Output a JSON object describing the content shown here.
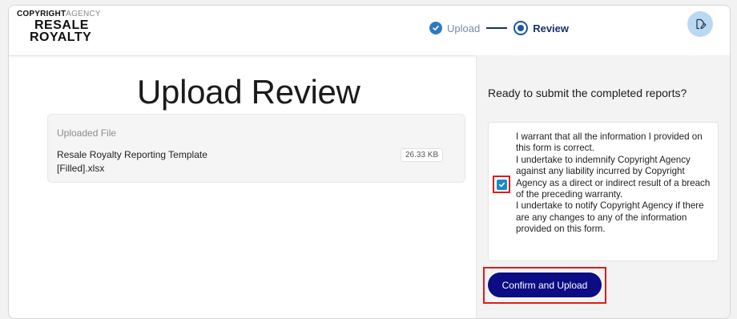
{
  "logo": {
    "line1_bold": "COPYRIGHT",
    "line1_light": "AGENCY",
    "line2": "RESALE",
    "line3": "ROYALTY"
  },
  "stepper": {
    "steps": [
      {
        "label": "Upload",
        "state": "done",
        "icon": "check-circle-icon"
      },
      {
        "label": "Review",
        "state": "active",
        "icon": "radio-dot-icon"
      }
    ],
    "colors": {
      "done": "#2c7bc1",
      "active": "#1a2f6b"
    }
  },
  "header": {
    "action_icon": "edit-document-icon",
    "action_color": "#b9d8f2"
  },
  "main": {
    "title": "Upload Review",
    "file_section": {
      "header": "Uploaded File",
      "file_name": "Resale Royalty Reporting Template [Filled].xlsx",
      "file_size": "26.33 KB"
    }
  },
  "panel": {
    "question": "Ready to submit the completed reports?",
    "warranty": {
      "lines": [
        "I warrant that all the information I provided on this form is correct.",
        "I undertake to indemnify Copyright Agency against any liability incurred by Copyright Agency as a direct or indirect result of a breach of the preceding warranty.",
        "I undertake to notify Copyright Agency if there are any changes to any of the information provided on this form."
      ],
      "checked": true
    },
    "confirm_label": "Confirm and Upload",
    "colors": {
      "button": "#0c0c84",
      "checkbox": "#1a8bc9",
      "highlight": "#e11b1b"
    }
  }
}
